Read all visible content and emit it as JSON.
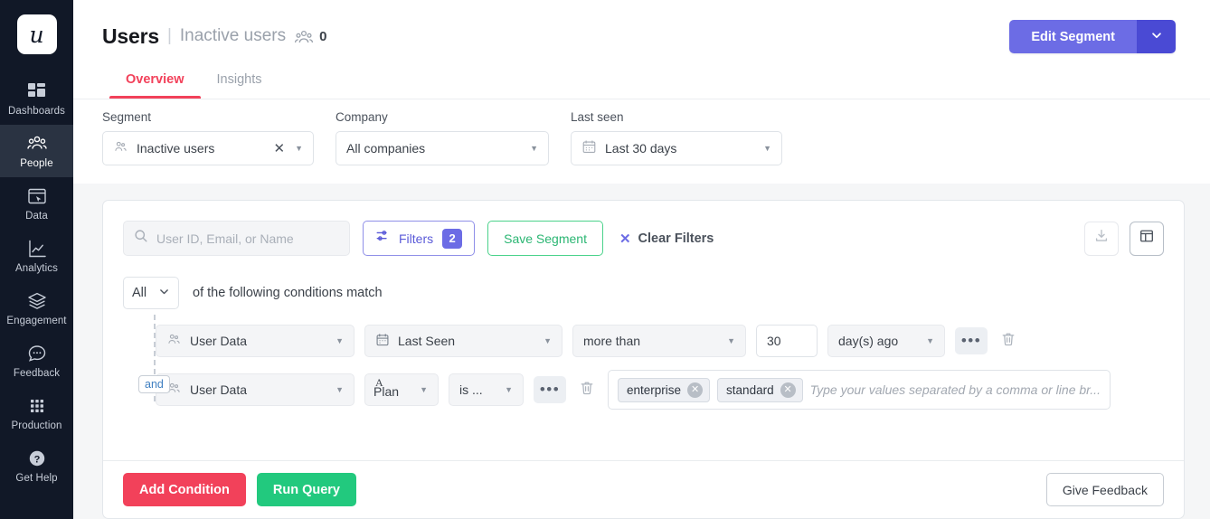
{
  "sidebar": {
    "logo_letter": "u",
    "items": [
      {
        "label": "Dashboards",
        "icon": "grid-dashboard-icon",
        "active": false
      },
      {
        "label": "People",
        "icon": "people-icon",
        "active": true
      },
      {
        "label": "Data",
        "icon": "data-window-icon",
        "active": false
      },
      {
        "label": "Analytics",
        "icon": "line-chart-icon",
        "active": false
      },
      {
        "label": "Engagement",
        "icon": "layers-icon",
        "active": false
      },
      {
        "label": "Feedback",
        "icon": "chat-bubble-icon",
        "active": false
      },
      {
        "label": "Production",
        "icon": "apps-dots-icon",
        "active": false
      },
      {
        "label": "Get Help",
        "icon": "question-circle-icon",
        "active": false
      }
    ]
  },
  "header": {
    "title": "Users",
    "separator": "|",
    "segment_name": "Inactive users",
    "member_count": "0",
    "edit_segment_label": "Edit Segment",
    "edit_segment_caret": "⌄"
  },
  "tabs": [
    {
      "label": "Overview",
      "active": true
    },
    {
      "label": "Insights",
      "active": false
    }
  ],
  "filterbar": {
    "segment": {
      "label": "Segment",
      "value": "Inactive users"
    },
    "company": {
      "label": "Company",
      "value": "All companies"
    },
    "lastseen": {
      "label": "Last seen",
      "value": "Last 30 days"
    }
  },
  "toolbar": {
    "search_placeholder": "User ID, Email, or Name",
    "search_value": "",
    "filters_label": "Filters",
    "filters_count": "2",
    "save_segment_label": "Save Segment",
    "clear_filters_label": "Clear Filters",
    "download_icon": "download-icon",
    "columns_icon": "table-columns-icon"
  },
  "conditions": {
    "match_mode": "All",
    "match_text": "of the following conditions match",
    "connector": "and",
    "rows": [
      {
        "source": "User Data",
        "field": "Last Seen",
        "operator": "more than",
        "number": "30",
        "unit": "day(s) ago",
        "more_label": "•••"
      },
      {
        "source": "User Data",
        "field_type": "A",
        "field": "Plan",
        "operator": "is ...",
        "more_label": "•••",
        "tags": [
          "enterprise",
          "standard"
        ],
        "tags_placeholder": "Type your values separated by a comma or line br..."
      }
    ]
  },
  "footer": {
    "add_condition_label": "Add Condition",
    "run_query_label": "Run Query",
    "give_feedback_label": "Give Feedback"
  },
  "colors": {
    "brand_purple": "#6c6ce5",
    "accent_pink": "#f2415a",
    "success_green": "#22c97e",
    "sidebar_bg": "#111827"
  }
}
